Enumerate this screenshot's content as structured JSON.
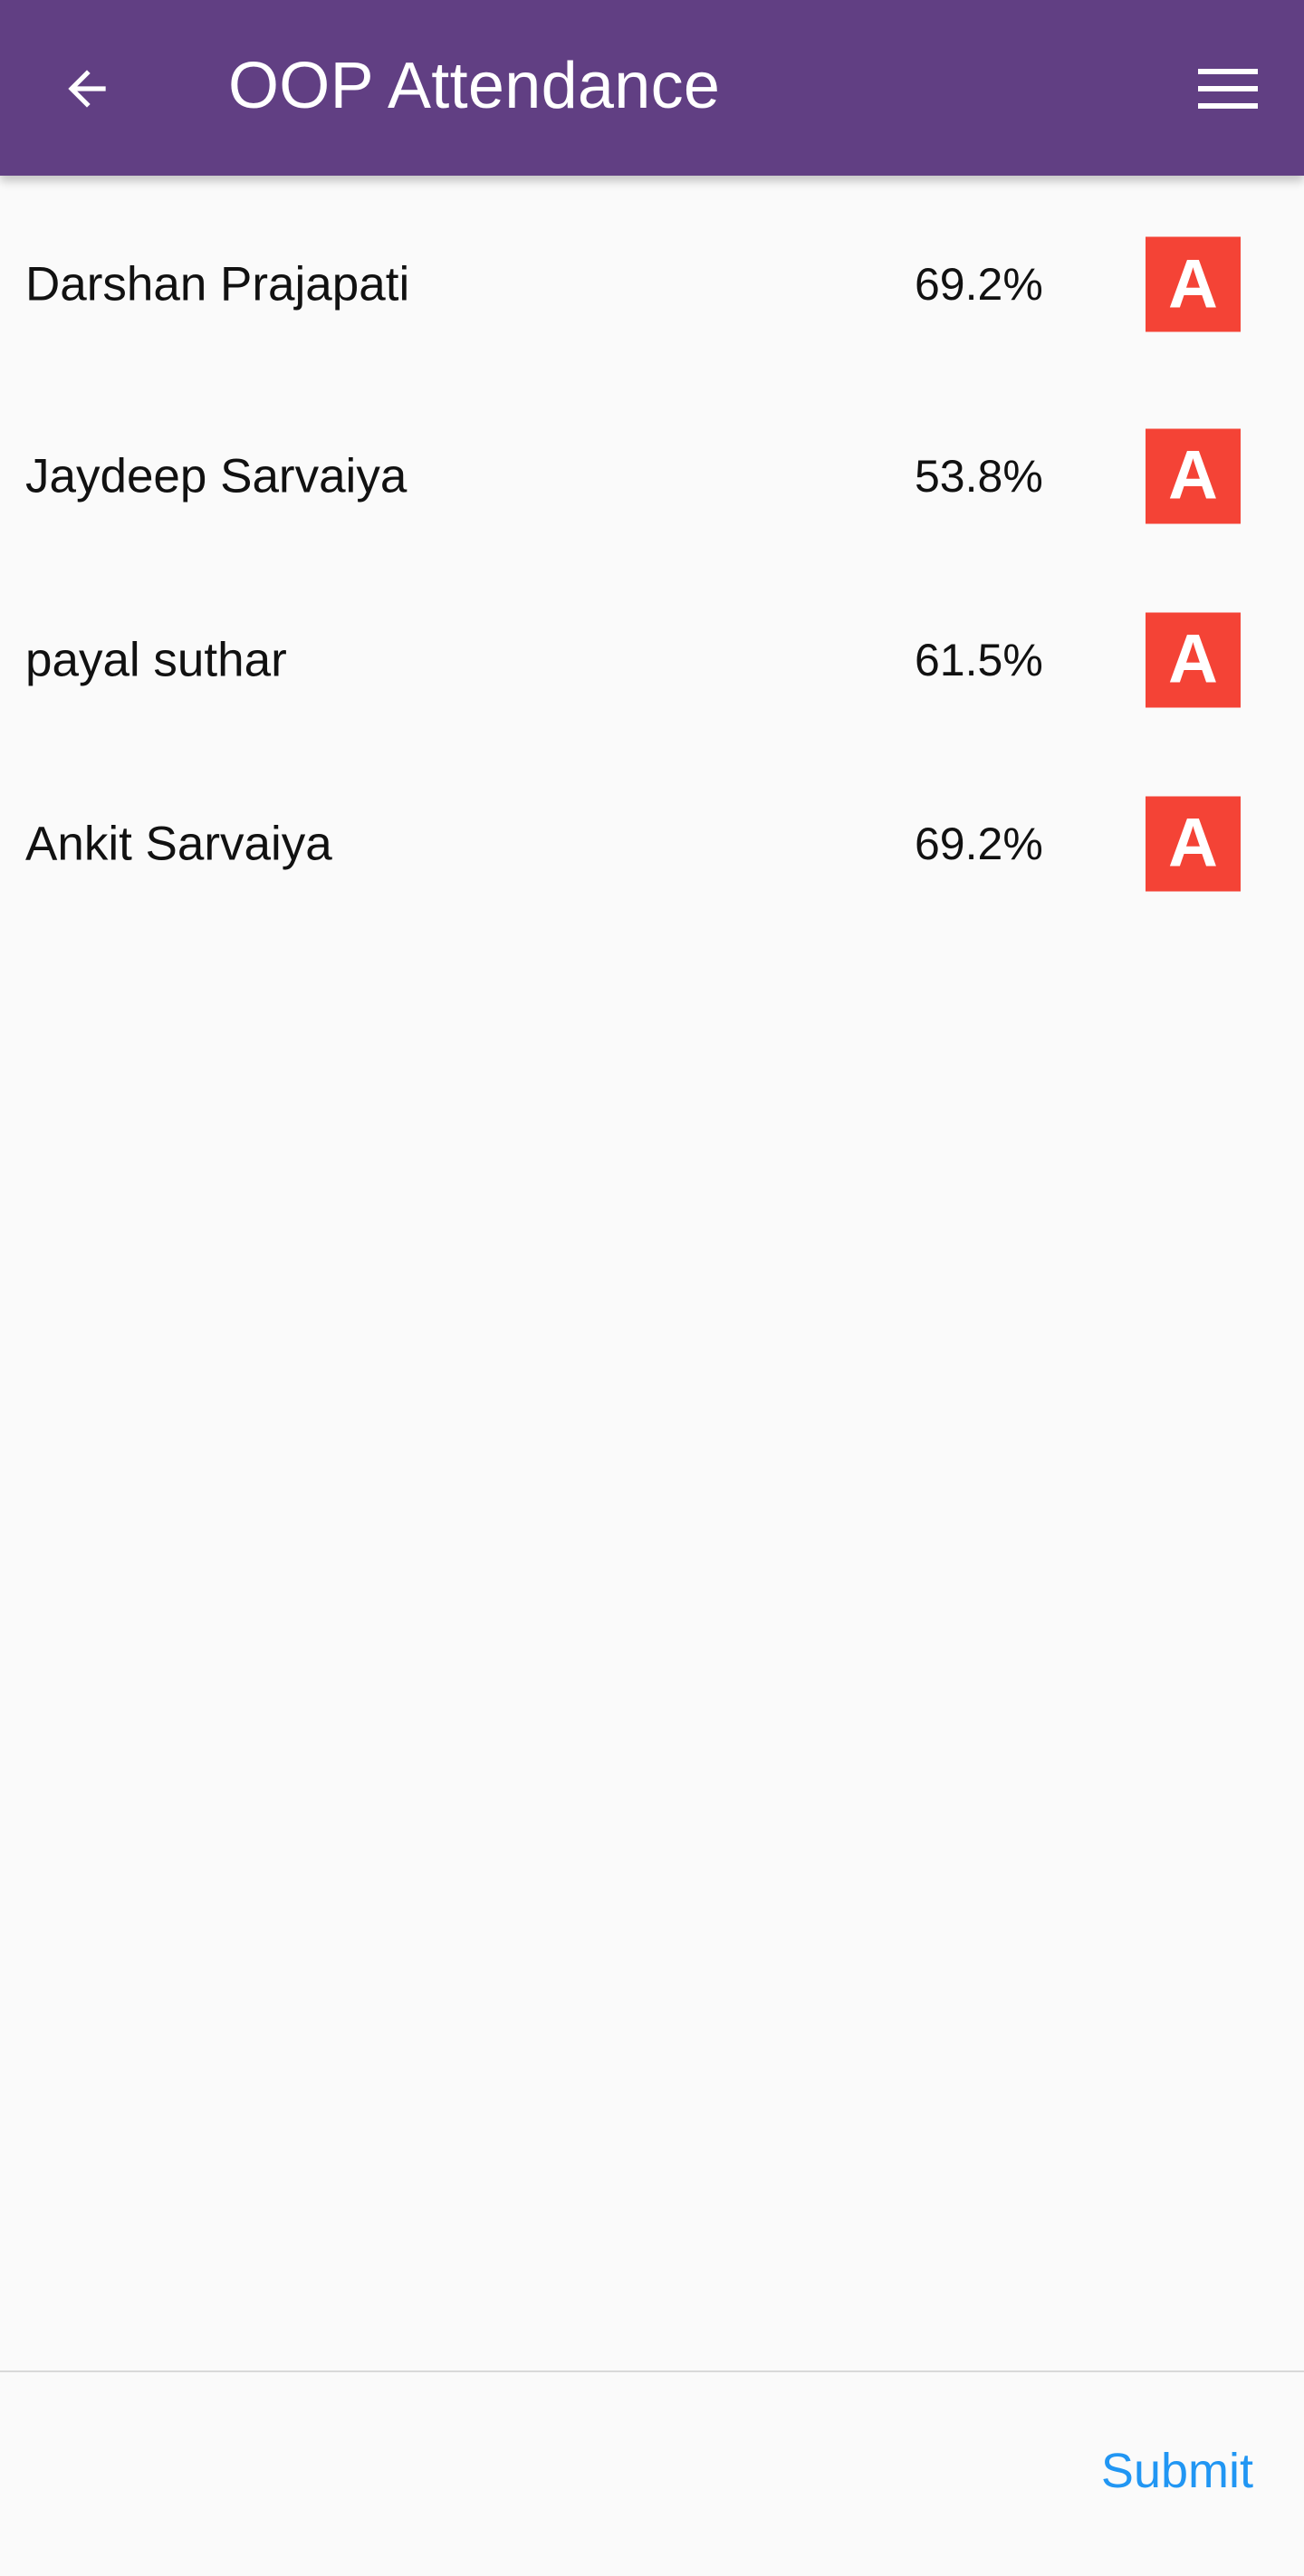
{
  "app_bar": {
    "title": "OOP Attendance",
    "back_icon": "arrow-left-icon",
    "menu_icon": "hamburger-menu-icon",
    "background_color": "#613f83"
  },
  "students": [
    {
      "name": "Darshan Prajapati",
      "percentage": "69.2%",
      "status": "A"
    },
    {
      "name": "Jaydeep Sarvaiya",
      "percentage": "53.8%",
      "status": "A"
    },
    {
      "name": "payal suthar",
      "percentage": "61.5%",
      "status": "A"
    },
    {
      "name": "Ankit Sarvaiya",
      "percentage": "69.2%",
      "status": "A"
    }
  ],
  "footer": {
    "submit_label": "Submit"
  },
  "colors": {
    "absent": "#f44336",
    "submit": "#2196f3"
  }
}
